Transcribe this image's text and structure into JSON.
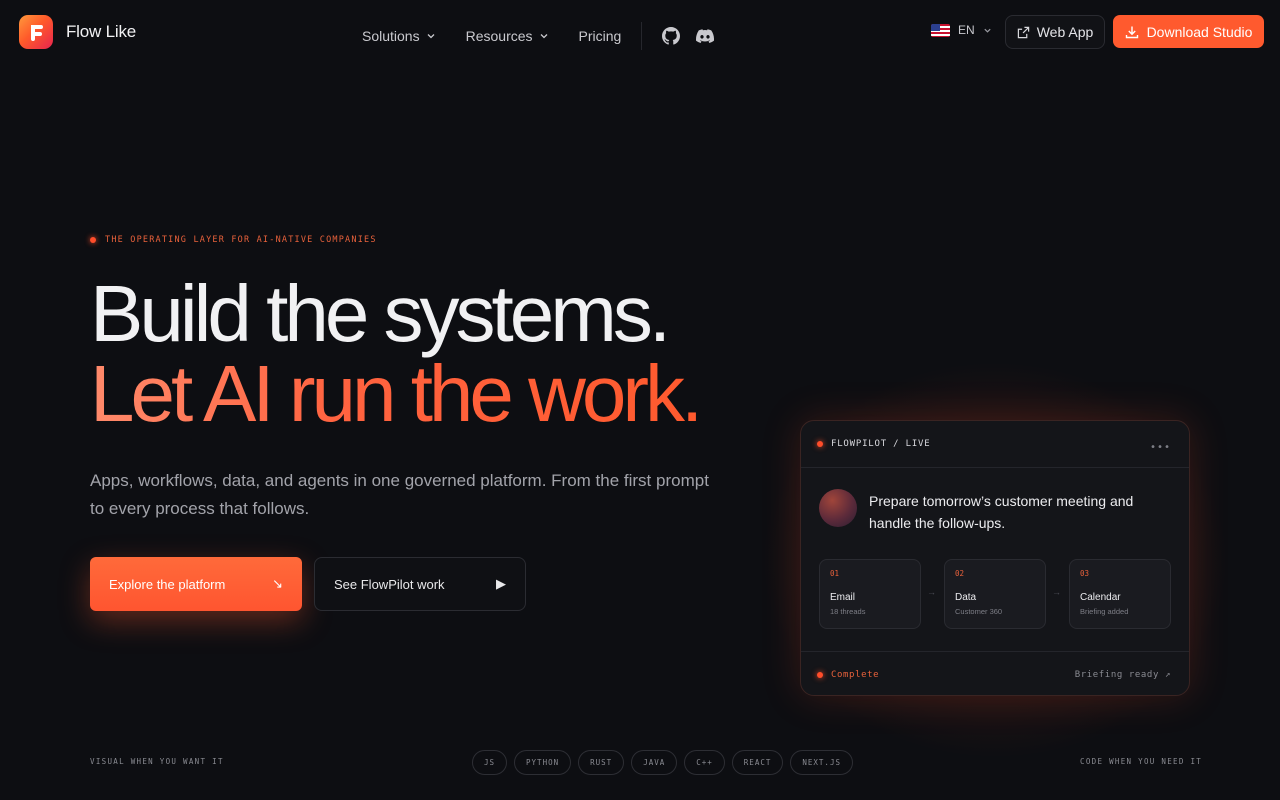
{
  "brand": {
    "name": "Flow Like",
    "accent": "#ff5a2e"
  },
  "nav": {
    "links": [
      {
        "label": "Solutions",
        "has_dropdown": true
      },
      {
        "label": "Resources",
        "has_dropdown": true
      },
      {
        "label": "Pricing",
        "has_dropdown": false
      }
    ],
    "icons": [
      "github-icon",
      "discord-icon"
    ],
    "language": "EN",
    "web_app_label": "Web App",
    "download_label": "Download Studio"
  },
  "hero": {
    "eyebrow": "THE OPERATING LAYER FOR AI-NATIVE COMPANIES",
    "headline_1": "Build the systems.",
    "headline_2": "Let AI run the work.",
    "lede": "Apps, workflows, data, and agents in one governed platform. From the first prompt to every process that follows.",
    "primary_cta": "Explore the platform",
    "primary_cta_icon": "↘",
    "secondary_cta": "See FlowPilot work",
    "secondary_cta_icon": "▶"
  },
  "card": {
    "header": "FLOWPILOT / LIVE",
    "more_icon": "•••",
    "prompt": "Prepare tomorrow’s customer meeting and handle the follow-ups.",
    "steps": [
      {
        "num": "01",
        "title": "Email",
        "sub": "18 threads"
      },
      {
        "num": "02",
        "title": "Data",
        "sub": "Customer 360"
      },
      {
        "num": "03",
        "title": "Calendar",
        "sub": "Briefing added"
      }
    ],
    "arrow": "→",
    "status": "Complete",
    "result": "Briefing ready ↗"
  },
  "footer": {
    "left": "VISUAL WHEN YOU WANT IT",
    "right": "CODE WHEN YOU NEED IT",
    "languages": [
      "JS",
      "PYTHON",
      "RUST",
      "JAVA",
      "C++",
      "REACT",
      "NEXT.JS"
    ]
  }
}
